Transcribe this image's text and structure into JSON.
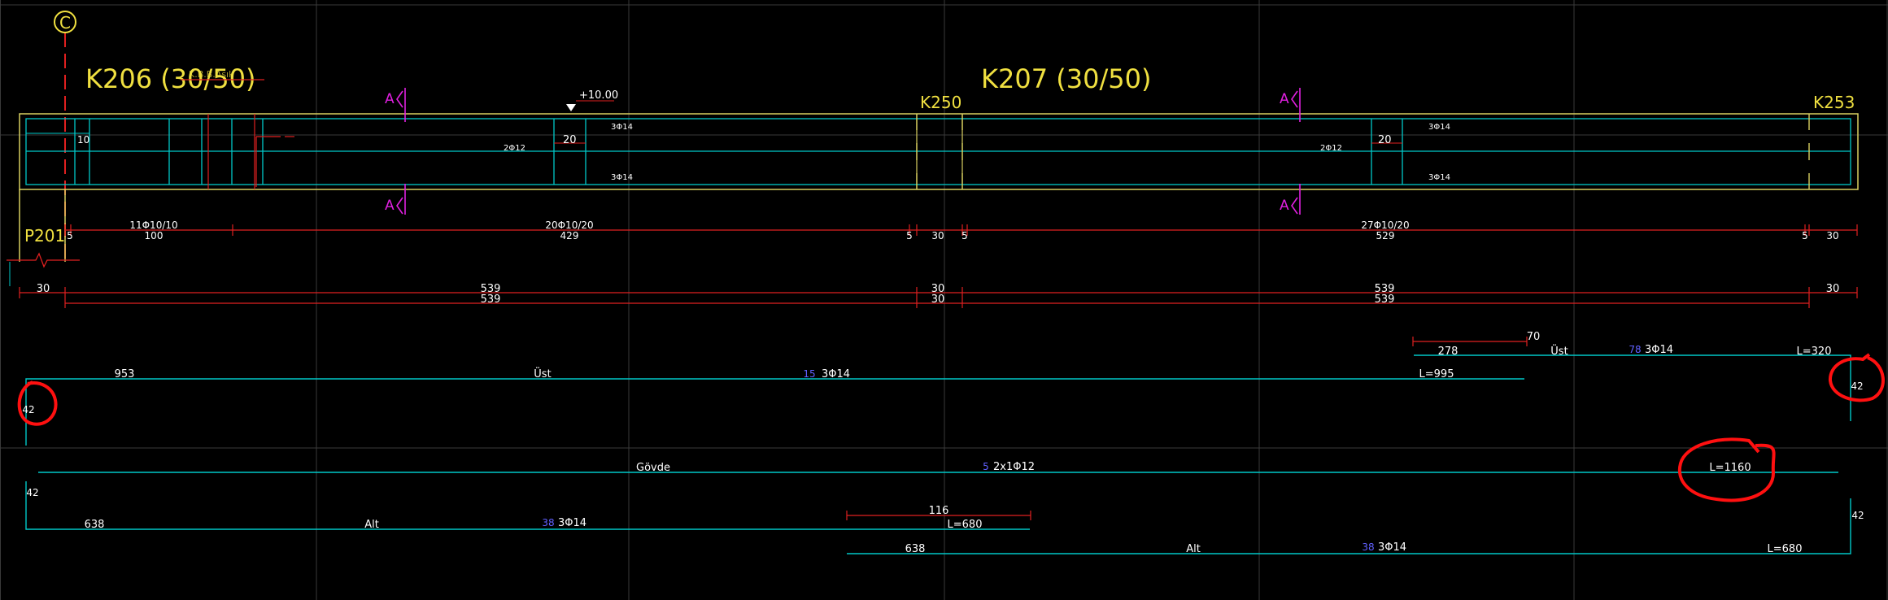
{
  "colors": {
    "background": "#000000",
    "grid": "#3a3a3a",
    "beam_outline": "#d8d060",
    "rebar": "#00c8c8",
    "dimension": "#e02020",
    "section_marker": "#e020e0",
    "title": "#f0e040",
    "label": "#ffffff",
    "bar_number": "#6060ff",
    "annotation": "#ff1010"
  },
  "axis_label": "C",
  "beams": [
    {
      "name": "K206 (30/50)"
    },
    {
      "name": "K207 (30/50)"
    }
  ],
  "columns": [
    "K250",
    "K253"
  ],
  "support": "P201",
  "level": "+10.00",
  "faint_label": "K.B.B.Asık",
  "section_marks": [
    "A",
    "A",
    "A",
    "A"
  ],
  "cross_section_labels": [
    "10",
    "20",
    "20",
    "3Φ14",
    "3Φ14",
    "3Φ14",
    "3Φ14",
    "2Φ12",
    "2Φ12"
  ],
  "stirrups": [
    {
      "label": "11Φ10/10",
      "length": "100"
    },
    {
      "label": "20Φ10/20",
      "length": "429"
    },
    {
      "label": "27Φ10/20",
      "length": "529"
    }
  ],
  "stirrup_gaps": [
    "5",
    "5",
    "30",
    "5",
    "5",
    "30"
  ],
  "dim_row1": [
    "30",
    "539",
    "30",
    "539",
    "30"
  ],
  "dim_row2": [
    "539",
    "30",
    "539"
  ],
  "bars": [
    {
      "pos": "15",
      "spec": "3Φ14",
      "layer": "Üst",
      "straight": "953",
      "hook": "42",
      "total": "L=995"
    },
    {
      "pos": "78",
      "spec": "3Φ14",
      "layer": "Üst",
      "straight": "278",
      "hook": "42",
      "total": "L=320",
      "extra": "70"
    },
    {
      "pos": "5",
      "spec": "2x1Φ12",
      "layer": "Gövde",
      "total": "L=1160"
    },
    {
      "pos": "38",
      "spec": "3Φ14",
      "layer": "Alt",
      "straight": "638",
      "hook": "42",
      "total": "L=680",
      "extra": "116"
    },
    {
      "pos": "38",
      "spec": "3Φ14",
      "layer": "Alt",
      "straight": "638",
      "hook": "42",
      "total": "L=680"
    }
  ]
}
